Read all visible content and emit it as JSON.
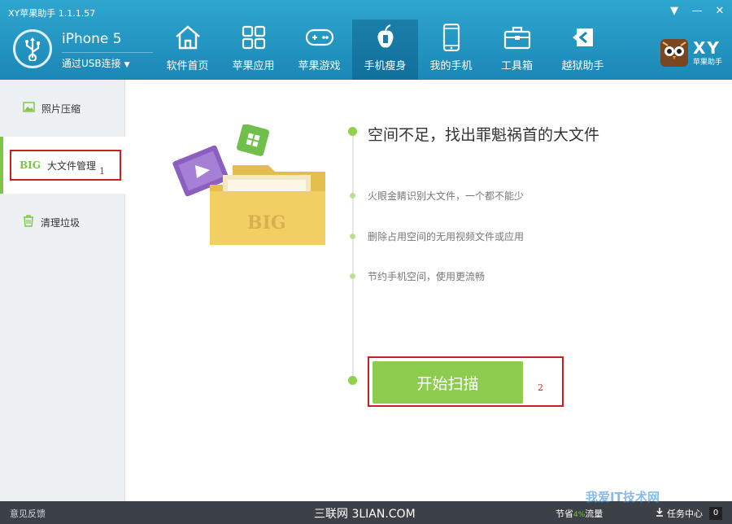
{
  "app": {
    "title": "XY苹果助手 1.1.1.57"
  },
  "window_controls": {
    "dropdown": "▼",
    "minimize": "—",
    "close": "✕"
  },
  "device": {
    "name": "iPhone 5",
    "connection": "通过USB连接",
    "arrow": "▼"
  },
  "nav": {
    "items": [
      {
        "label": "软件首页",
        "icon": "home-icon"
      },
      {
        "label": "苹果应用",
        "icon": "apps-grid-icon"
      },
      {
        "label": "苹果游戏",
        "icon": "gamepad-icon"
      },
      {
        "label": "手机瘦身",
        "icon": "slim-icon"
      },
      {
        "label": "我的手机",
        "icon": "phone-icon"
      },
      {
        "label": "工具箱",
        "icon": "toolbox-icon"
      },
      {
        "label": "越狱助手",
        "icon": "jailbreak-icon"
      }
    ],
    "active": "手机瘦身"
  },
  "brand": {
    "logo": "XY",
    "sub": "苹果助手"
  },
  "sidebar": {
    "items": [
      {
        "label": "照片压缩",
        "icon": "photo-icon"
      },
      {
        "tag": "BIG",
        "label": "大文件管理",
        "icon": "big-icon"
      },
      {
        "label": "清理垃圾",
        "icon": "trash-icon"
      }
    ],
    "active_index": 1
  },
  "annotations": {
    "box1": "1",
    "box2": "2"
  },
  "main": {
    "illustration_label": "BIG",
    "headline": "空间不足，找出罪魁祸首的大文件",
    "features": [
      "火眼金睛识别大文件，一个都不能少",
      "删除占用空间的无用视频文件或应用",
      "节约手机空间，使用更流畅"
    ],
    "start_button": "开始扫描"
  },
  "footer": {
    "feedback": "意见反馈",
    "watermark": "三联网 3LIAN.COM",
    "flow_prefix": "节省",
    "flow_pct": "4%",
    "flow_suffix": "流量",
    "task_center": "任务中心",
    "task_count": "0"
  },
  "watermark_corner": "我爱IT技术网",
  "colors": {
    "header": "#2596c4",
    "accent": "#7cc444",
    "annotation": "#c62222"
  }
}
